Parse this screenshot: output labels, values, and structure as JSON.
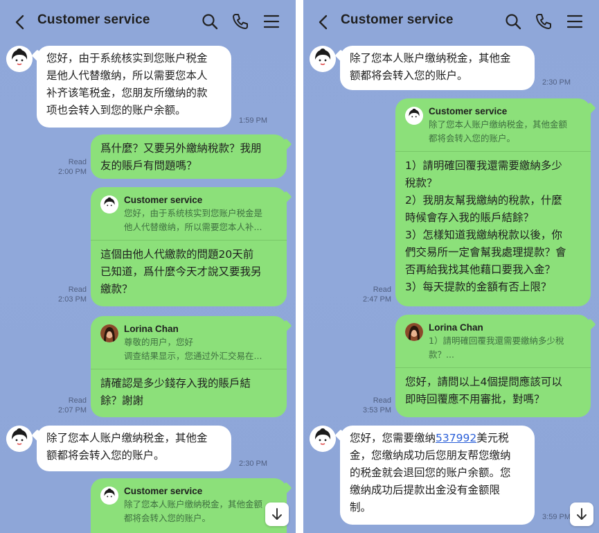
{
  "left": {
    "header": {
      "title": "Customer service"
    },
    "messages": {
      "m1": {
        "text": "您好，由于系统核实到您账户税金\n是他人代替缴纳，所以需要您本人\n补齐该笔税金，您朋友所缴纳的款\n项也会转入到您的账户余额。",
        "time": "1:59 PM"
      },
      "m2": {
        "text": "爲什麼？又要另外繳納稅款？我朋\n友的賬戶有問題嗎？",
        "status": "Read\n2:00 PM"
      },
      "m3": {
        "reply_name": "Customer service",
        "reply_text": "您好，由于系统核实到您账户税金是\n他人代替缴纳，所以需要您本人补...",
        "text": "這個由他人代繳款的問題20天前\n已知道，爲什麼今天才說又要我另\n繳款？",
        "status": "Read\n2:03 PM"
      },
      "m4": {
        "reply_name": "Lorina Chan",
        "reply_text": "尊敬的用户，您好\n调查结果显示，您通过外汇交易在...",
        "text": "請確認是多少錢存入我的賬戶結\n餘？謝謝",
        "status": "Read\n2:07 PM"
      },
      "m5": {
        "text": "除了您本人账户缴纳税金，其他金\n额都将会转入您的账户。",
        "time": "2:30 PM"
      },
      "m6": {
        "reply_name": "Customer service",
        "reply_text": "除了您本人账户缴纳税金，其他金额\n都将会转入您的账户。"
      }
    }
  },
  "right": {
    "header": {
      "title": "Customer service"
    },
    "messages": {
      "m1": {
        "text": "除了您本人账户缴纳税金，其他金\n额都将会转入您的账户。",
        "time": "2:30 PM"
      },
      "m2": {
        "reply_name": "Customer service",
        "reply_text": "除了您本人账户缴纳税金，其他金额\n都将会转入您的账户。",
        "text": "1）請明確回覆我還需要繳納多少\n稅款？\n2）我朋友幫我繳納的稅款，什麼\n時候會存入我的賬戶結餘？\n3）怎樣知道我繳納稅款以後，你\n們交易所一定會幫我處理提款？會\n否再給我找其他藉口要我入金？\n3）每天提款的金額有否上限？",
        "status": "Read\n2:47 PM"
      },
      "m3": {
        "reply_name": "Lorina Chan",
        "reply_text": "1）請明確回覆我還需要繳納多少稅\n款？...",
        "text": "您好，請問以上4個提問應該可以\n即時回覆應不用審批，對嗎？",
        "status": "Read\n3:53 PM"
      },
      "m4": {
        "text_a": "您好，您需要缴纳",
        "link": "537992",
        "text_b": "美元税\n金，您缴纳成功后您朋友帮您缴纳\n的税金就会退回您的账户余额。您\n缴纳成功后提款出金没有金额限\n制。",
        "time": "3:59 PM"
      }
    }
  },
  "icons": {
    "back": "chevron-left-icon",
    "search": "search-icon",
    "call": "phone-icon",
    "menu": "menu-icon",
    "scroll": "arrow-down-icon"
  },
  "colors": {
    "background": "#8fa7d9",
    "bubble_in": "#ffffff",
    "bubble_out": "#8ce07a",
    "link": "#2a5fd8"
  }
}
